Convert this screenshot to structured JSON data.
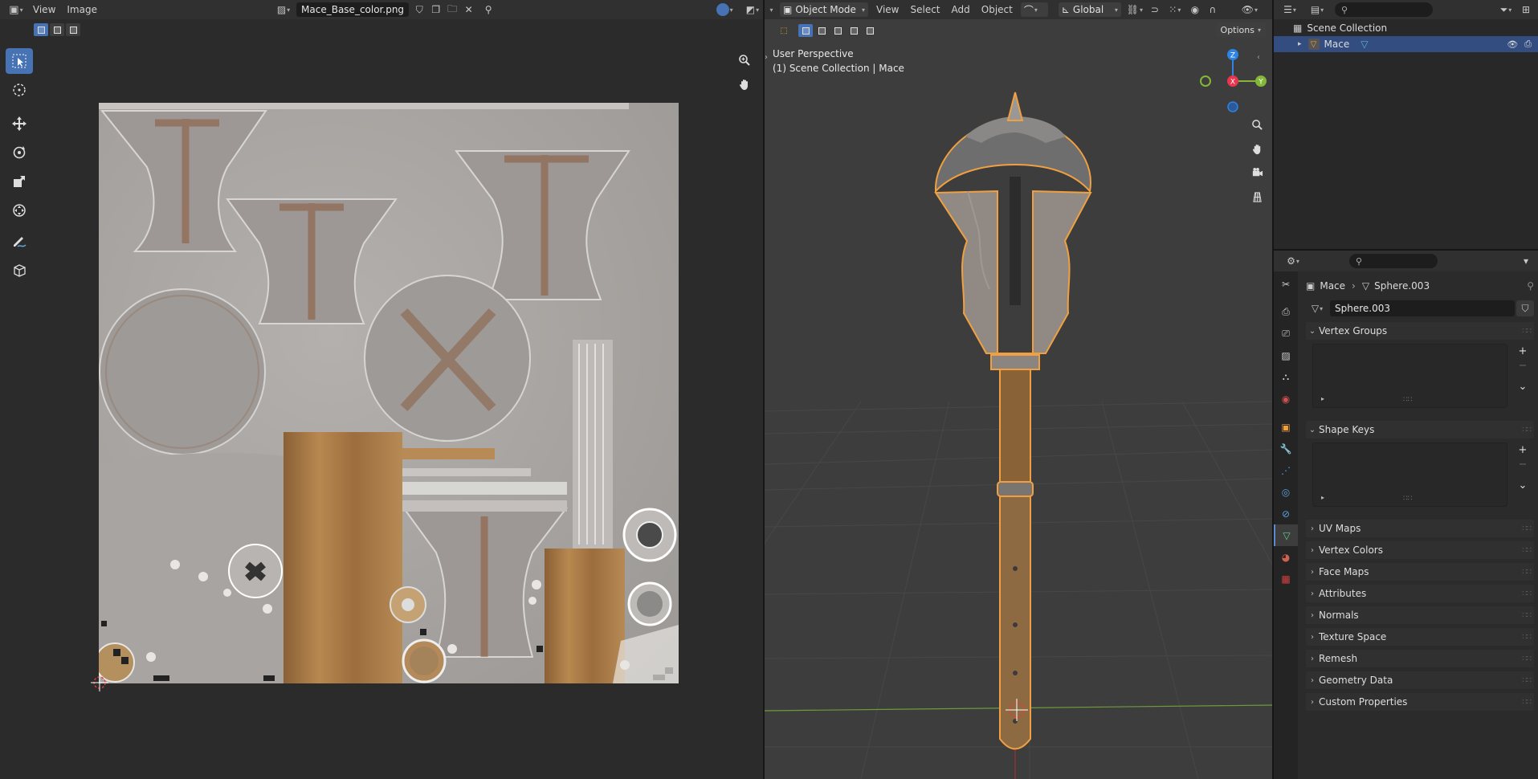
{
  "image_editor": {
    "menus": [
      "View",
      "Image"
    ],
    "image_name": "Mace_Base_color.png"
  },
  "viewport": {
    "mode": "Object Mode",
    "menus": [
      "View",
      "Select",
      "Add",
      "Object"
    ],
    "transform_orientation": "Global",
    "options_label": "Options",
    "info_line1": "User Perspective",
    "info_line2": "(1) Scene Collection | Mace",
    "gizmo_axes": {
      "x": "X",
      "y": "Y",
      "z": "Z"
    }
  },
  "outliner": {
    "scene_collection": "Scene Collection",
    "object_name": "Mace"
  },
  "properties": {
    "breadcrumb_object": "Mace",
    "breadcrumb_mesh": "Sphere.003",
    "mesh_datablock": "Sphere.003",
    "panels": {
      "vertex_groups": "Vertex Groups",
      "shape_keys": "Shape Keys",
      "uv_maps": "UV Maps",
      "vertex_colors": "Vertex Colors",
      "face_maps": "Face Maps",
      "attributes": "Attributes",
      "normals": "Normals",
      "texture_space": "Texture Space",
      "remesh": "Remesh",
      "geometry_data": "Geometry Data",
      "custom_properties": "Custom Properties"
    }
  },
  "colors": {
    "accent_blue": "#4772b3",
    "selection_highlight": "#334d80",
    "axis_x": "#e8364f",
    "axis_y": "#84b737",
    "axis_z": "#2f83e3",
    "object_outline": "#f0a040"
  }
}
